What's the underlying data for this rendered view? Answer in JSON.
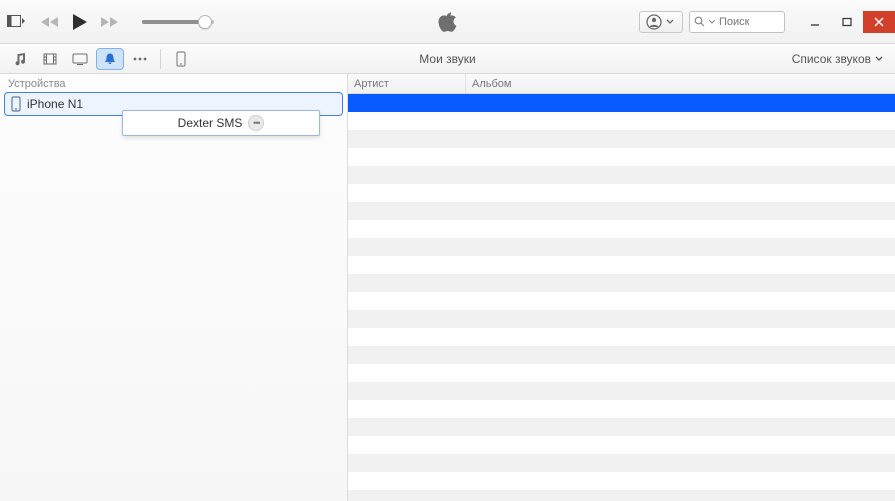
{
  "window": {
    "title": "Мои звуки"
  },
  "search": {
    "placeholder": "Поиск"
  },
  "view_toggle": {
    "label": "Список звуков"
  },
  "columns": {
    "artist": "Артист",
    "album": "Альбом"
  },
  "sidebar": {
    "section_label": "Устройства",
    "device_name": "iPhone N1"
  },
  "drag": {
    "item_name": "Dexter SMS"
  },
  "volume": {
    "percent": 88
  },
  "colors": {
    "accent": "#0a5bff",
    "selected_border": "#3d7ff0",
    "close_btn": "#d0402b"
  }
}
